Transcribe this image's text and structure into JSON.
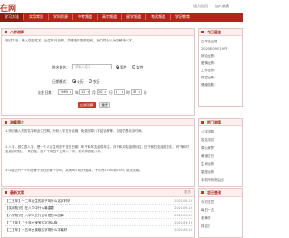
{
  "header": {
    "logo": "在网",
    "top_links": [
      "设为首页",
      "加入收藏"
    ]
  },
  "nav": {
    "items": [
      "学习方法",
      "实用常识",
      "学科资源",
      "中考频道",
      "高考频道",
      "留学频道",
      "考试频道",
      "学历教育",
      "教育资讯",
      "实用文档"
    ]
  },
  "tool": {
    "heading": "八字测算",
    "description": "测试方法：输入您的姓名，出生年月日期，并请选择您的性别，我们将会以为您解读八字。",
    "name_label": "姓名姓名：",
    "name_placeholder": "请输入姓名",
    "gender_male": "男性",
    "gender_female": "女性",
    "calendar_label": "日期模式：",
    "calendar_solar": "公历",
    "calendar_lunar": "农历",
    "birth_label": "出生日期：",
    "year_value": "1989",
    "year_unit": "年",
    "month_value": "12",
    "month_unit": "月",
    "day_value": "20",
    "day_unit": "日",
    "hour_value": "8",
    "hour_unit": "时",
    "minute_value": "37",
    "minute_unit": "分",
    "submit_label": "立即测算",
    "reset_label": "重置"
  },
  "intro": {
    "heading": "测算简介",
    "paragraphs": [
      "1.测试输入您的名字和出生日期，分析八字五行合格，免费测算八字结合等等，自信仍看北京时间。",
      "2.八字，即生辰八字，是一个人出生时的干支历日期，年干和年支组成年柱，月干和月支组成月柱，日干和日支组成日柱，时干和时支组成时柱，一共四柱，四个干和四个支共八个字，故又称四柱八字。",
      "3.中国古代一个时辰等于现在的两个小时，从夜间11点开始算，子时为23:00到1:00，依次类推。"
    ]
  },
  "articles": {
    "heading": "最新文章",
    "more": "更多",
    "rows": [
      {
        "title": "【二五年】一二年出生的孩子叫什么名字好听",
        "date": "2020-09-19"
      },
      {
        "title": "【实用知识】在八字中什么最重要",
        "date": "2020-09-19"
      },
      {
        "title": "【八字知识】八字中五行互补是怎么回事",
        "date": "2020-09-19"
      },
      {
        "title": "【二五年】二十年女宝宝名字怎么取",
        "date": "2020-09-19"
      },
      {
        "title": "【二五年】一五年女孩取名字带什么字最好",
        "date": "2020-09-19"
      }
    ]
  },
  "sidebar": {
    "box1_heading": "今日星座",
    "box1_lines": [
      "白羊座运势",
      "2020年09月19日",
      "综合运势：",
      "爱情运势：",
      "工作运势：",
      "财富运势：",
      "健康指数："
    ],
    "box2_heading": "热门测算",
    "box2_lines": [
      "八字测算",
      "姓名测试",
      "周公解梦",
      "黄道吉日",
      "生肖运势",
      "星座运势",
      "手机号码测吉凶"
    ],
    "box3_heading": "吉日查询",
    "box3_lines": [
      "今日宜忌",
      "每日一占",
      "老黄历",
      "择吉日"
    ]
  }
}
